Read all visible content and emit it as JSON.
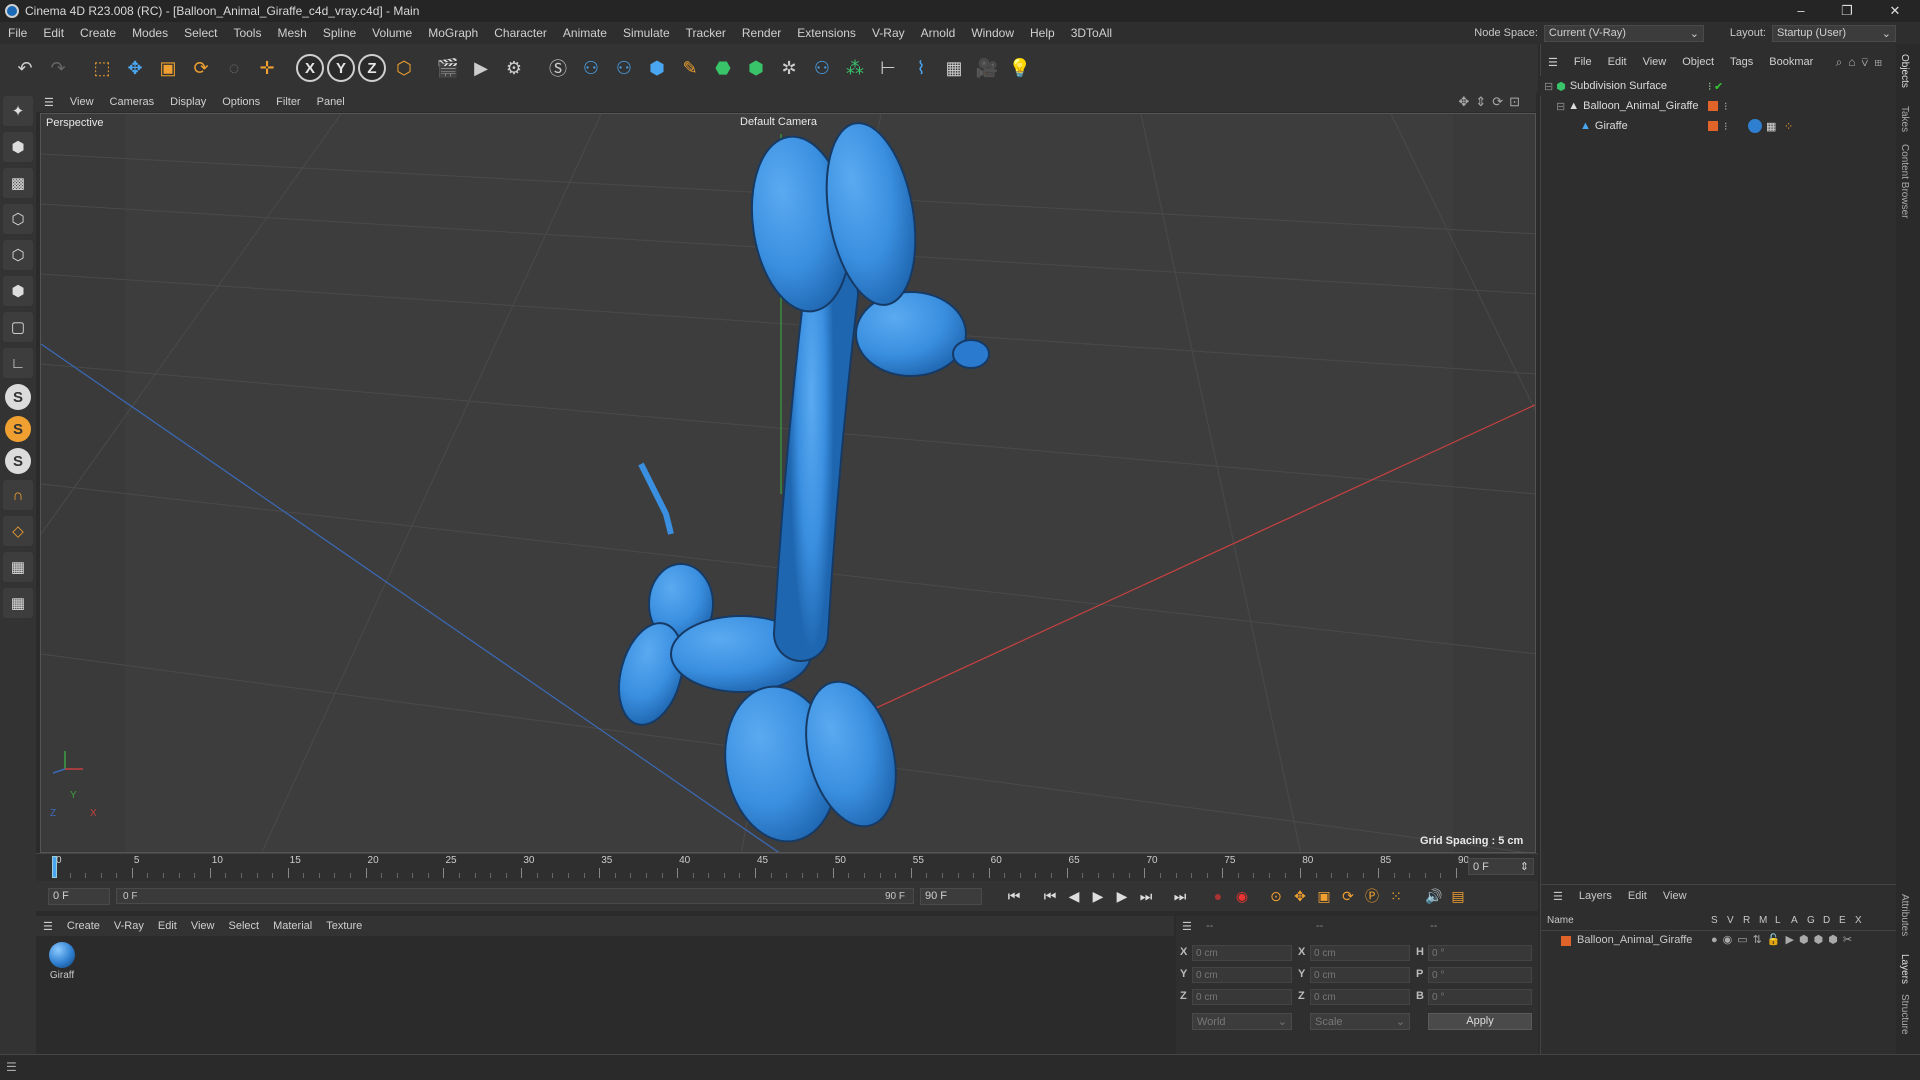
{
  "window": {
    "title": "Cinema 4D R23.008 (RC) - [Balloon_Animal_Giraffe_c4d_vray.c4d] - Main",
    "minimize": "–",
    "maximize": "❐",
    "close": "✕"
  },
  "menu": [
    "File",
    "Edit",
    "Create",
    "Modes",
    "Select",
    "Tools",
    "Mesh",
    "Spline",
    "Volume",
    "MoGraph",
    "Character",
    "Animate",
    "Simulate",
    "Tracker",
    "Render",
    "Extensions",
    "V-Ray",
    "Arnold",
    "Window",
    "Help",
    "3DToAll"
  ],
  "node_space": {
    "label": "Node Space:",
    "value": "Current (V-Ray)"
  },
  "layout": {
    "label": "Layout:",
    "value": "Startup (User)"
  },
  "toolbar": {
    "x": "X",
    "y": "Y",
    "z": "Z"
  },
  "viewport": {
    "menu": [
      "View",
      "Cameras",
      "Display",
      "Options",
      "Filter",
      "Panel"
    ],
    "label": "Perspective",
    "camera": "Default Camera",
    "grid_spacing": "Grid Spacing : 5 cm",
    "axis_y": "Y",
    "axis_x": "X",
    "axis_z": "Z"
  },
  "timeline": {
    "ticks": [
      "0",
      "5",
      "10",
      "15",
      "20",
      "25",
      "30",
      "35",
      "40",
      "45",
      "50",
      "55",
      "60",
      "65",
      "70",
      "75",
      "80",
      "85",
      "90"
    ],
    "current_frame": "0 F",
    "start": "0 F",
    "range_start": "0 F",
    "range_end": "90 F",
    "end": "90 F"
  },
  "materials": {
    "menu": [
      "Create",
      "V-Ray",
      "Edit",
      "View",
      "Select",
      "Material",
      "Texture"
    ],
    "items": [
      {
        "name": "Giraff",
        "color": "#2f7fd0"
      }
    ]
  },
  "coords": {
    "header": [
      "--",
      "--",
      "--"
    ],
    "rows": [
      {
        "a": "X",
        "av": "0 cm",
        "b": "X",
        "bv": "0 cm",
        "c": "H",
        "cv": "0 °"
      },
      {
        "a": "Y",
        "av": "0 cm",
        "b": "Y",
        "bv": "0 cm",
        "c": "P",
        "cv": "0 °"
      },
      {
        "a": "Z",
        "av": "0 cm",
        "b": "Z",
        "bv": "0 cm",
        "c": "B",
        "cv": "0 °"
      }
    ],
    "mode1": "World",
    "mode2": "Scale",
    "apply": "Apply"
  },
  "objects": {
    "menu": [
      "File",
      "Edit",
      "View",
      "Object",
      "Tags",
      "Bookmar"
    ],
    "items": [
      {
        "name": "Subdivision Surface",
        "indent": 0
      },
      {
        "name": "Balloon_Animal_Giraffe",
        "indent": 1
      },
      {
        "name": "Giraffe",
        "indent": 2
      }
    ]
  },
  "layers": {
    "menu": [
      "Layers",
      "Edit",
      "View"
    ],
    "columns": [
      "Name",
      "S",
      "V",
      "R",
      "M",
      "L",
      "A",
      "G",
      "D",
      "E",
      "X"
    ],
    "items": [
      {
        "name": "Balloon_Animal_Giraffe",
        "color": "#e0642a"
      }
    ]
  },
  "side_tabs": [
    "Objects",
    "Takes",
    "Content Browser",
    "Attributes",
    "Layers",
    "Structure"
  ],
  "colors": {
    "balloon": "#3a8fe0",
    "balloon_dark": "#1f66b0",
    "accent": "#f0a030",
    "x_axis": "#c84040",
    "z_axis": "#3a6ab8",
    "y_axis": "#3aa040"
  }
}
